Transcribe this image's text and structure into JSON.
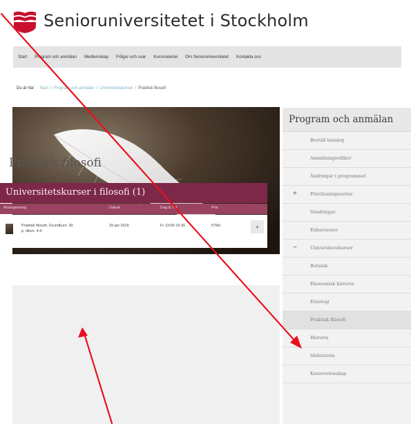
{
  "header": {
    "site_title": "Senioruniversitetet i Stockholm"
  },
  "nav": [
    "Start",
    "Program och anmälan",
    "Medlemskap",
    "Frågor och svar",
    "Kursmaterial",
    "Om Senioruniversitetet",
    "Kontakta oss"
  ],
  "breadcrumb": {
    "lead": "Du är här:",
    "links": [
      "Start",
      "Program och anmälan",
      "Universitetskurser"
    ],
    "current": "Praktisk filosofi"
  },
  "main": {
    "hero_image": "feather-photo",
    "title": "Praktisk filosofi",
    "course_heading": "Universitetskurser i filosofi (1)",
    "columns": [
      "Arrangemang",
      "Datum",
      "Dag & Tid",
      "Pris"
    ],
    "rows": [
      {
        "arrangement_line1": "Praktisk filosofi. Grundkurs: 30",
        "arrangement_line2": "p. tillsm. 4:4",
        "date": "29 jan 2016",
        "day_time": "Fr 13:00-15:30",
        "price": "675kr",
        "add_label": "+"
      }
    ]
  },
  "sidebar": {
    "title": "Program och anmälan",
    "items": [
      {
        "label": "Beställ katalog",
        "marker": ""
      },
      {
        "label": "Anmälningsvillkor",
        "marker": ""
      },
      {
        "label": "Ändringar i programmet",
        "marker": ""
      },
      {
        "label": "Föreläsningsserier",
        "marker": "+"
      },
      {
        "label": "Vandringar",
        "marker": ""
      },
      {
        "label": "Exkursioner",
        "marker": ""
      },
      {
        "label": "Universitetskurser",
        "marker": "−"
      },
      {
        "label": "Botanik",
        "marker": ""
      },
      {
        "label": "Ekonomisk historia",
        "marker": ""
      },
      {
        "label": "Etnologi",
        "marker": ""
      },
      {
        "label": "Praktisk filosofi",
        "marker": "",
        "active": true
      },
      {
        "label": "Historia",
        "marker": ""
      },
      {
        "label": "Idéhistoria",
        "marker": ""
      },
      {
        "label": "Konstvetenskap",
        "marker": ""
      }
    ]
  },
  "colors": {
    "brand_red": "#c8102e",
    "course_header": "#7d2848",
    "column_header": "#994360",
    "arrow": "#e8101e",
    "link": "#7fb3c9"
  }
}
